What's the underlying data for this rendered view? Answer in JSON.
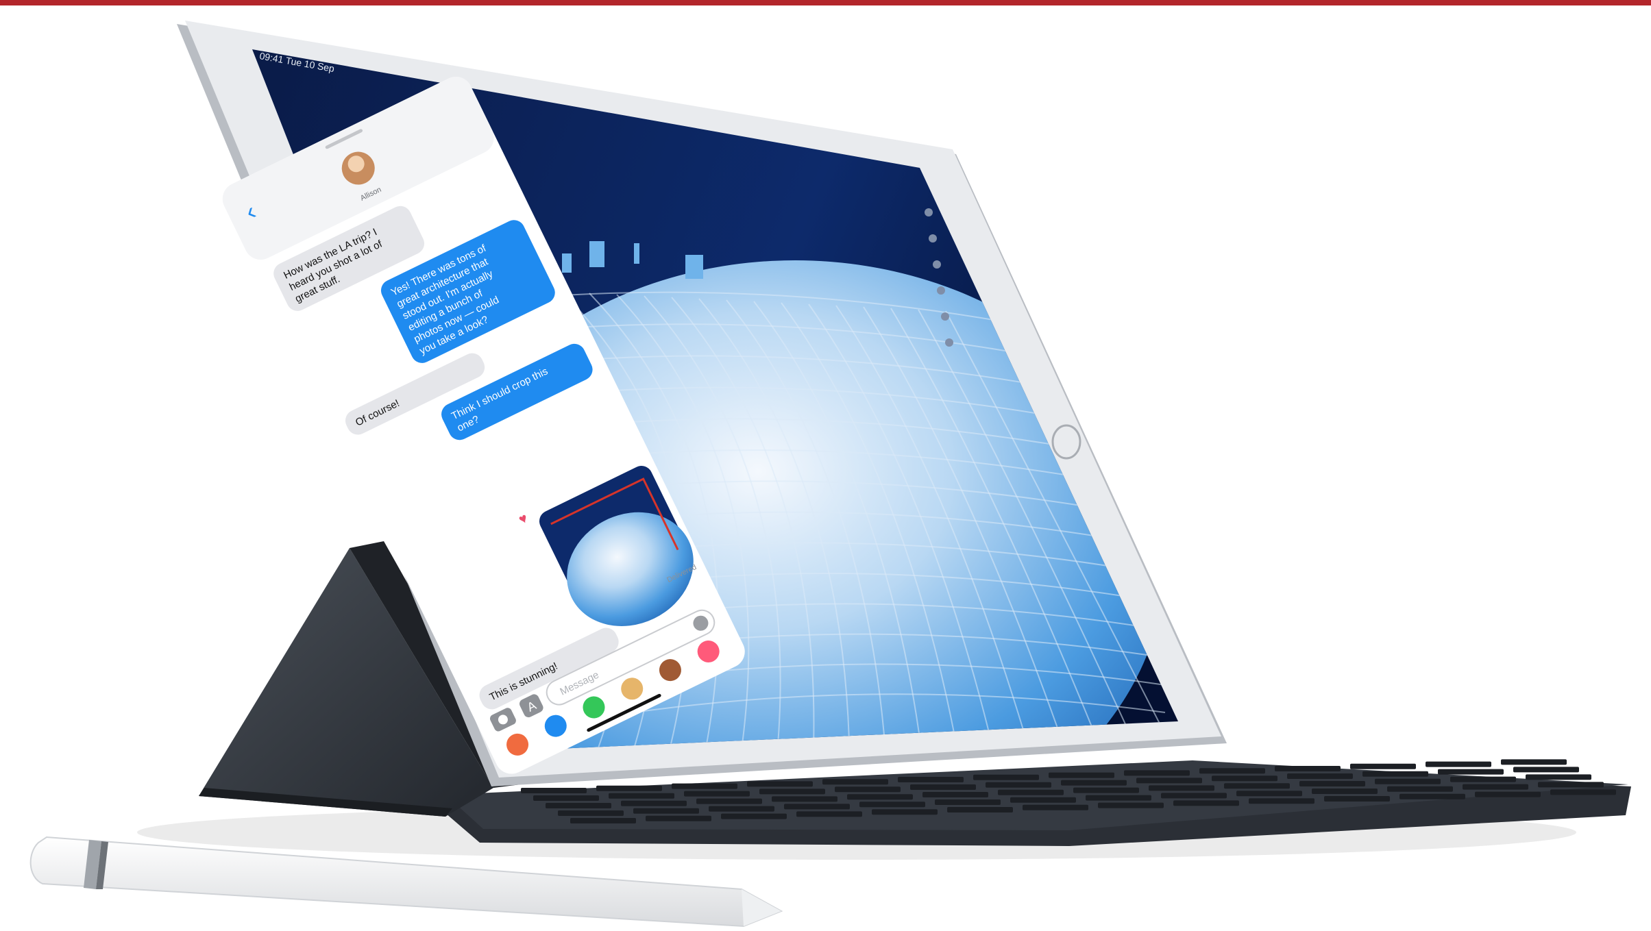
{
  "scene": {
    "top_bar_color": "#b3262b",
    "device_color": "#e9ebee",
    "keyboard_color": "#2b2f36",
    "screen_bg": "#0b1d4a",
    "dome_light": "#e9f1fb",
    "dome_mid": "#5da8e3",
    "dome_dark": "#1f66b8",
    "imessage_blue": "#1f8bf0"
  },
  "status_bar": {
    "time_date": "09:41  Tue 10 Sep"
  },
  "messages": {
    "contact_name": "Allison",
    "thread": [
      {
        "side": "left",
        "text": [
          "How was the LA trip? I",
          "heard you shot a lot of",
          "great stuff."
        ]
      },
      {
        "side": "right",
        "text": [
          "Yes! There was tons of",
          "great architecture that",
          "stood out. I'm actually",
          "editing a bunch of",
          "photos now — could",
          "you take a look?"
        ]
      },
      {
        "side": "left",
        "text": [
          "Of course!"
        ]
      },
      {
        "side": "right",
        "text": [
          "Think I should crop this",
          "one?"
        ]
      },
      {
        "side": "left",
        "text": [
          "This is stunning!"
        ]
      }
    ],
    "delivered": "Delivered",
    "compose_placeholder": "Message"
  },
  "icons": {
    "back": "chevron-left-icon",
    "camera": "camera-icon",
    "appstore": "app-store-icon",
    "mic": "microphone-icon",
    "photos": "photos-app-icon",
    "heart": "heart-tapback-icon"
  }
}
